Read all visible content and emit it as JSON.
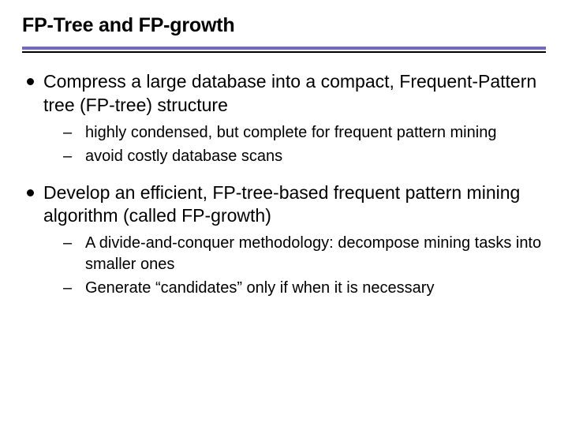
{
  "title": "FP-Tree and FP-growth",
  "bullets": [
    {
      "text": "Compress a large database into a compact, Frequent-Pattern tree (FP-tree) structure",
      "sub": [
        "highly condensed, but complete for frequent pattern mining",
        "avoid costly database scans"
      ]
    },
    {
      "text": "Develop an efficient, FP-tree-based frequent pattern mining algorithm (called FP-growth)",
      "sub": [
        "A divide-and-conquer methodology: decompose mining tasks into smaller ones",
        "Generate “candidates” only if when it is necessary"
      ]
    }
  ],
  "dash": "–"
}
